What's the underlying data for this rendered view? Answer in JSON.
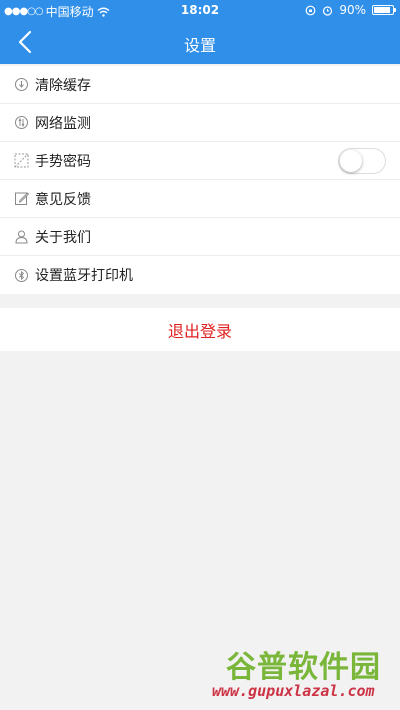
{
  "status": {
    "carrier": "中国移动",
    "time": "18:02",
    "battery_text": "90%",
    "battery_level": 0.9
  },
  "navbar": {
    "title": "设置"
  },
  "menu": [
    {
      "label": "清除缓存",
      "icon": "clear-cache-icon"
    },
    {
      "label": "网络监测",
      "icon": "network-icon"
    },
    {
      "label": "手势密码",
      "icon": "gesture-icon",
      "toggle": false
    },
    {
      "label": "意见反馈",
      "icon": "feedback-icon"
    },
    {
      "label": "关于我们",
      "icon": "user-icon"
    },
    {
      "label": "设置蓝牙打印机",
      "icon": "bluetooth-icon"
    }
  ],
  "logout": {
    "label": "退出登录"
  },
  "watermark": {
    "title": "谷普软件园",
    "url": "www.gupuxlazal.com"
  },
  "colors": {
    "primary": "#2f8fe9",
    "danger": "#e02020"
  }
}
